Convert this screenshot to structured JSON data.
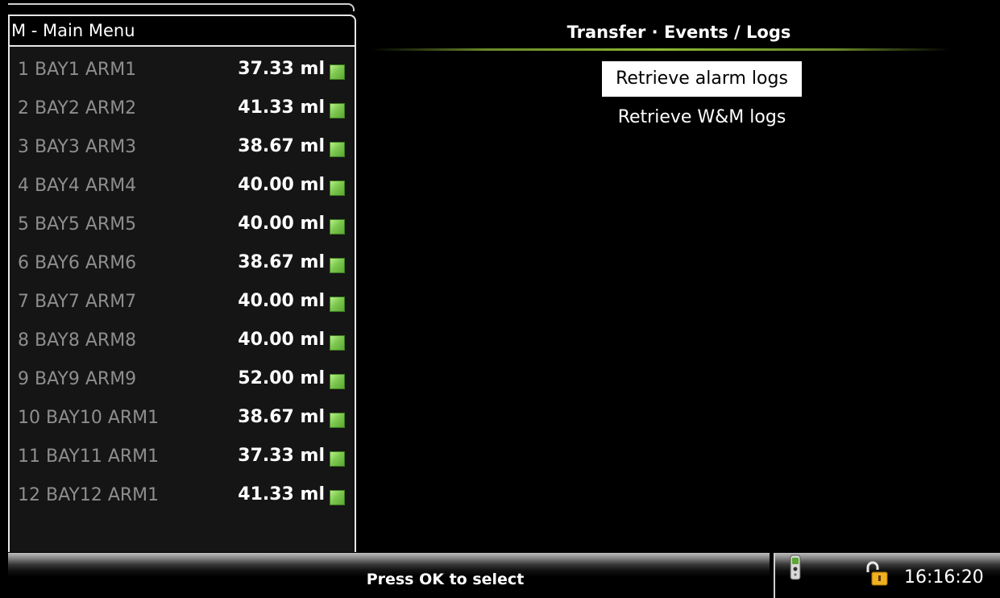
{
  "menu": {
    "title": "M - Main Menu"
  },
  "arms": [
    {
      "label": "1   BAY1 ARM1",
      "value": "37.33 ml",
      "status": "ok"
    },
    {
      "label": "2   BAY2 ARM2",
      "value": "41.33 ml",
      "status": "ok"
    },
    {
      "label": "3   BAY3 ARM3",
      "value": "38.67 ml",
      "status": "ok"
    },
    {
      "label": "4   BAY4 ARM4",
      "value": "40.00 ml",
      "status": "ok"
    },
    {
      "label": "5   BAY5 ARM5",
      "value": "40.00 ml",
      "status": "ok"
    },
    {
      "label": "6   BAY6 ARM6",
      "value": "38.67 ml",
      "status": "ok"
    },
    {
      "label": "7   BAY7 ARM7",
      "value": "40.00 ml",
      "status": "ok"
    },
    {
      "label": "8   BAY8 ARM8",
      "value": "40.00 ml",
      "status": "ok"
    },
    {
      "label": "9   BAY9 ARM9",
      "value": "52.00 ml",
      "status": "ok"
    },
    {
      "label": "10 BAY10 ARM1",
      "value": "38.67 ml",
      "status": "ok"
    },
    {
      "label": "11 BAY11 ARM1",
      "value": "37.33 ml",
      "status": "ok"
    },
    {
      "label": "12 BAY12 ARM1",
      "value": "41.33 ml",
      "status": "ok"
    }
  ],
  "content": {
    "title": "Transfer · Events / Logs",
    "options": [
      {
        "label": "Retrieve alarm logs",
        "selected": true
      },
      {
        "label": "Retrieve W&M logs",
        "selected": false
      }
    ]
  },
  "footer": {
    "hint": "Press OK to select"
  },
  "status": {
    "time": "16:16:20",
    "lock_state": "unlocked"
  },
  "colors": {
    "status_ok": "#7ec850",
    "accent_line": "#8ab832"
  }
}
